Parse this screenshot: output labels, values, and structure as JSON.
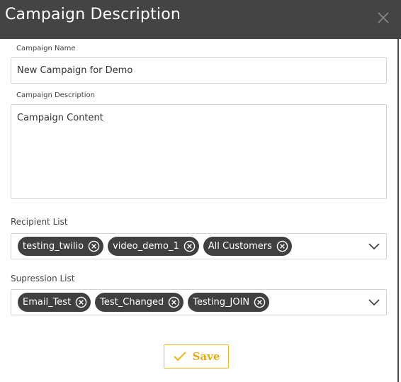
{
  "dialog": {
    "title": "Campaign Description"
  },
  "form": {
    "campaign_name_label": "Campaign Name",
    "campaign_name_value": "New Campaign for Demo",
    "campaign_description_label": "Campaign Description",
    "campaign_description_value": "Campaign Content",
    "recipient_list_label": "Recipient List",
    "recipient_list_tags": [
      "testing_twilio",
      "video_demo_1",
      "All Customers"
    ],
    "suppression_list_label": "Supression List",
    "suppression_list_tags": [
      "Email_Test",
      "Test_Changed",
      "Testing_JOIN"
    ]
  },
  "actions": {
    "save_label": "Save"
  },
  "colors": {
    "header_bg": "#444444",
    "chip_bg": "#404040",
    "accent": "#f0b81a"
  },
  "icons": {
    "close": "close-icon",
    "chip_remove": "circle-x-icon",
    "dropdown": "chevron-down-icon",
    "save": "check-icon"
  }
}
